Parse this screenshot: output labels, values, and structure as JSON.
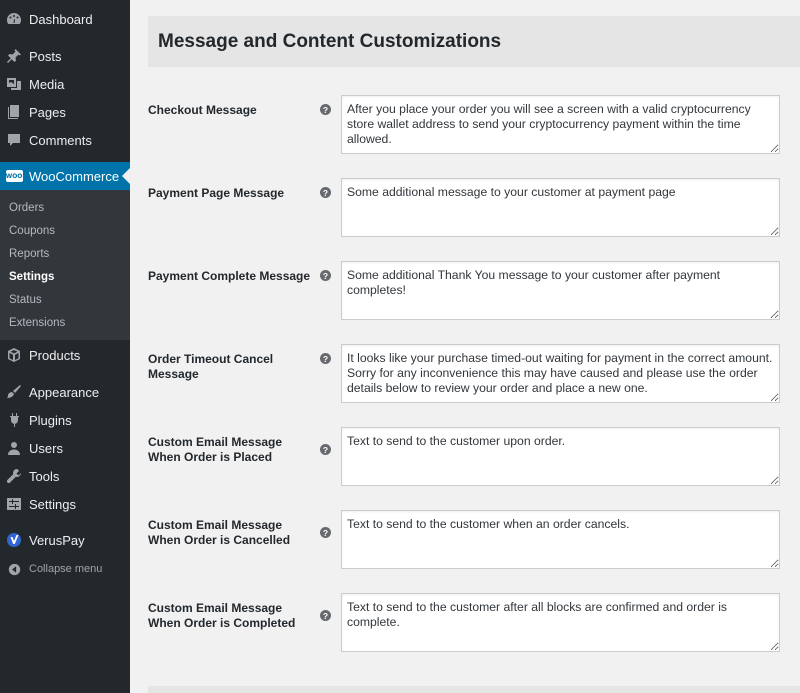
{
  "sidebar": {
    "dashboard": "Dashboard",
    "posts": "Posts",
    "media": "Media",
    "pages": "Pages",
    "comments": "Comments",
    "woocommerce": "WooCommerce",
    "woo_badge": "WOO",
    "woo_submenu": [
      "Orders",
      "Coupons",
      "Reports",
      "Settings",
      "Status",
      "Extensions"
    ],
    "products": "Products",
    "appearance": "Appearance",
    "plugins": "Plugins",
    "users": "Users",
    "tools": "Tools",
    "settings": "Settings",
    "veruspay": "VerusPay",
    "collapse": "Collapse menu",
    "active_color": "#0073aa"
  },
  "main": {
    "title": "Message and Content Customizations",
    "help_glyph": "?",
    "fields": [
      {
        "label": "Checkout Message",
        "value": "After you place your order you will see a screen with a valid cryptocurrency store wallet address to send your cryptocurrency payment within the time allowed."
      },
      {
        "label": "Payment Page Message",
        "value": "Some additional message to your customer at payment page"
      },
      {
        "label": "Payment Complete Message",
        "value": "Some additional Thank You message to your customer after payment completes!"
      },
      {
        "label": "Order Timeout Cancel Message",
        "value": "It looks like your purchase timed-out waiting for payment in the correct amount. Sorry for any inconvenience this may have caused and please use the order details below to review your order and place a new one."
      },
      {
        "label": "Custom Email Message When Order is Placed",
        "value": "Text to send to the customer upon order."
      },
      {
        "label": "Custom Email Message When Order is Cancelled",
        "value": "Text to send to the customer when an order cancels."
      },
      {
        "label": "Custom Email Message When Order is Completed",
        "value": "Text to send to the customer after all blocks are confirmed and order is complete."
      }
    ]
  }
}
